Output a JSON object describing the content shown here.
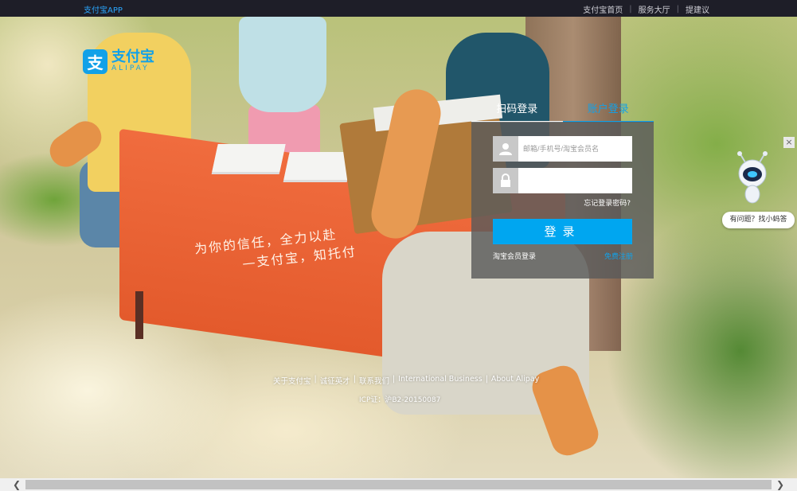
{
  "topbar": {
    "app_link": "支付宝APP",
    "links": [
      "支付宝首页",
      "服务大厅",
      "提建议"
    ],
    "separator": "|"
  },
  "logo": {
    "mark": "支",
    "name_cn": "支付宝",
    "name_en": "ALIPAY"
  },
  "hero": {
    "slogan_line1": "为你的信任，全力以赴",
    "slogan_line2": "—支付宝，知托付"
  },
  "login": {
    "tabs": [
      "扫码登录",
      "账户登录"
    ],
    "username_placeholder": "邮箱/手机号/淘宝会员名",
    "password_value": "",
    "forgot_label": "忘记登录密码?",
    "submit_label": "登录",
    "taobao_label": "淘宝会员登录",
    "register_label": "免费注册"
  },
  "assistant": {
    "close_label": "×",
    "bubble_label": "有问题？找小蚂答"
  },
  "footer": {
    "links": [
      "关于支付宝",
      "诚征英才",
      "联系我们",
      "International Business",
      "About Alipay"
    ],
    "separator": "|",
    "icp": "ICP证：沪B2-20150087"
  },
  "scrollbar": {
    "left_arrow": "❮",
    "right_arrow": "❯"
  },
  "colors": {
    "accent": "#00a6f0",
    "brand": "#12a1e8",
    "topbar_bg": "#1e1e28"
  }
}
